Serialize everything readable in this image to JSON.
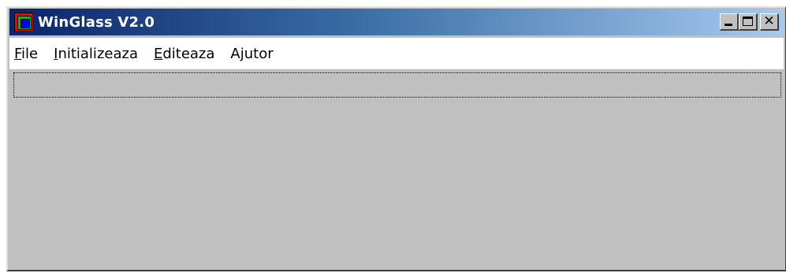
{
  "window": {
    "title": "WinGlass V2.0",
    "icon": "app-icon",
    "buttons": {
      "minimize": "minimize-icon",
      "maximize": "maximize-icon",
      "close": "close-icon",
      "close_glyph": "✕"
    }
  },
  "menu": {
    "items": [
      {
        "first": "F",
        "rest": "ile"
      },
      {
        "first": "I",
        "rest": "nitializeaza"
      },
      {
        "first": "E",
        "rest": "diteaza"
      },
      {
        "first": "",
        "rest": "Ajutor"
      }
    ]
  },
  "colors": {
    "titlebar_start": "#0a246a",
    "titlebar_end": "#a6caf0",
    "window_face": "#c0c0c0",
    "menubar_bg": "#ffffff"
  }
}
